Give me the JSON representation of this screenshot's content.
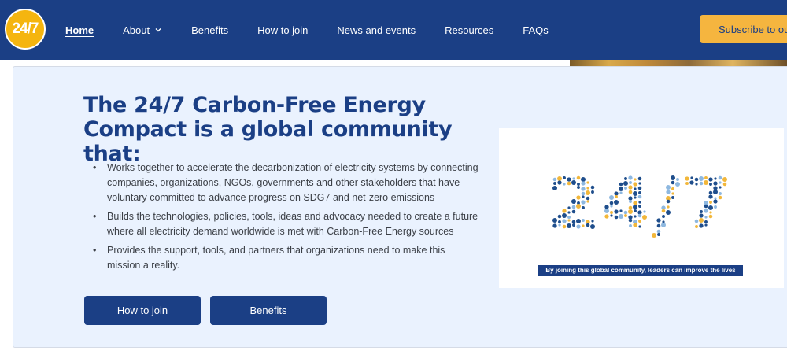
{
  "logo": {
    "text": "24/7"
  },
  "nav": {
    "items": [
      {
        "label": "Home",
        "active": true
      },
      {
        "label": "About",
        "has_dropdown": true
      },
      {
        "label": "Benefits"
      },
      {
        "label": "How to join"
      },
      {
        "label": "News and events"
      },
      {
        "label": "Resources"
      },
      {
        "label": "FAQs"
      }
    ],
    "subscribe_label": "Subscribe to ou"
  },
  "hero": {
    "title": "The 24/7 Carbon-Free Energy Compact is a global community that:",
    "bullets": [
      "Works together to accelerate the decarbonization of electricity systems by connecting companies, organizations, NGOs, governments and other stakeholders that have voluntary committed to advance progress on SDG7 and net-zero emissions",
      "Builds the technologies, policies, tools, ideas and advocacy needed to create a future where all electricity demand worldwide is met with Carbon-Free Energy sources",
      "Provides the support, tools, and partners that organizations need to make this mission a reality."
    ],
    "buttons": {
      "join_label": "How to join",
      "benefits_label": "Benefits"
    }
  },
  "graphic": {
    "dot_text": "24/7",
    "caption": "By joining this global community, leaders can improve the lives"
  },
  "colors": {
    "navy": "#1b3f85",
    "accent_yellow": "#f5b53f",
    "hero_bg": "#eaf2fe",
    "dot_blue": "#1f4e8c",
    "dot_light_blue": "#8eb8e0",
    "dot_yellow": "#f2b73a"
  }
}
